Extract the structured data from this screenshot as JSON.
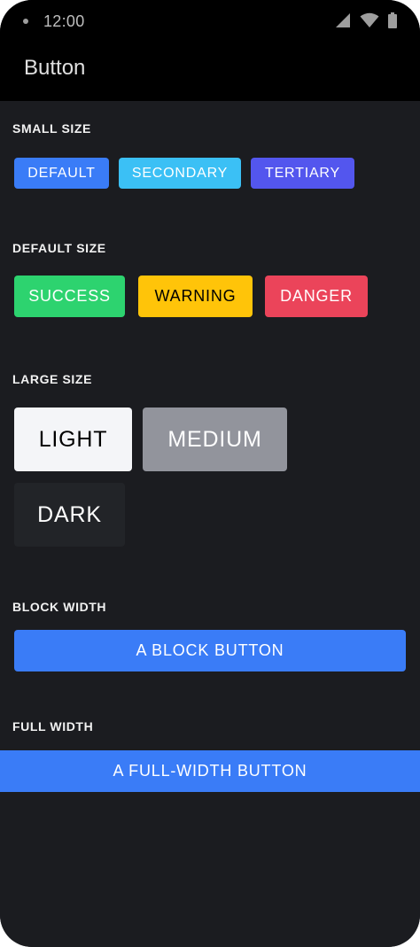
{
  "status_bar": {
    "time": "12:00"
  },
  "app_bar": {
    "title": "Button"
  },
  "sections": {
    "small": {
      "label": "SMALL SIZE",
      "buttons": {
        "default": "DEFAULT",
        "secondary": "SECONDARY",
        "tertiary": "TERTIARY"
      }
    },
    "default": {
      "label": "DEFAULT SIZE",
      "buttons": {
        "success": "SUCCESS",
        "warning": "WARNING",
        "danger": "DANGER"
      }
    },
    "large": {
      "label": "LARGE SIZE",
      "buttons": {
        "light": "LIGHT",
        "medium": "MEDIUM",
        "dark": "DARK"
      }
    },
    "block": {
      "label": "BLOCK WIDTH",
      "button": "A BLOCK BUTTON"
    },
    "full": {
      "label": "FULL WIDTH",
      "button": "A FULL-WIDTH BUTTON"
    }
  },
  "colors": {
    "primary": "#3a7cf7",
    "secondary": "#3bc0f5",
    "tertiary": "#5356ee",
    "success": "#2dd36f",
    "warning": "#ffc409",
    "danger": "#eb445a",
    "light": "#f4f5f8",
    "medium": "#92949c",
    "dark": "#222428",
    "background": "#1b1c20",
    "toolbar": "#000000"
  },
  "icons": {
    "signal": "signal-icon",
    "wifi": "wifi-icon",
    "battery": "battery-icon"
  }
}
